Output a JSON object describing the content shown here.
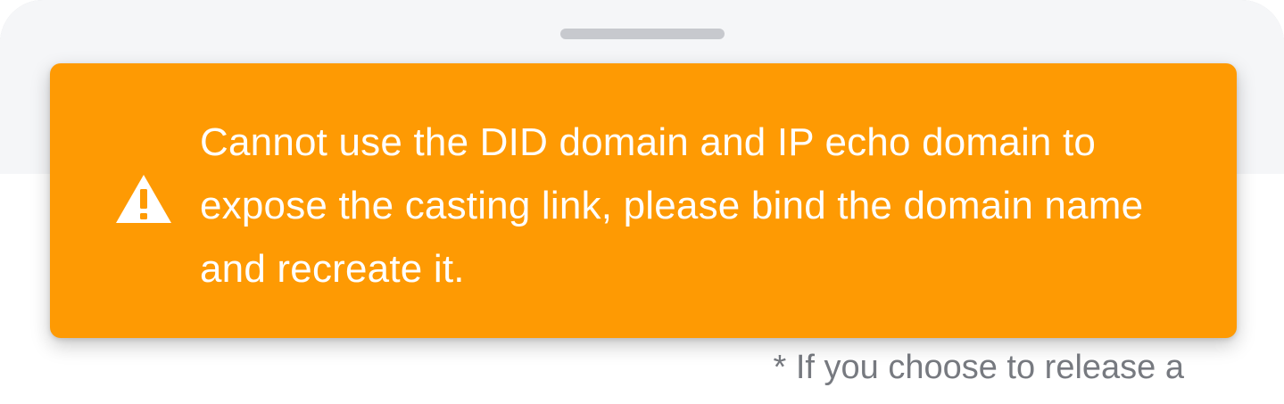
{
  "sheet": {
    "handle": "drag-handle"
  },
  "alert": {
    "type": "warning",
    "icon": "warning-triangle-icon",
    "message": "Cannot use the DID domain and IP echo domain to expose the casting link, please bind the domain name and recreate it.",
    "background_color": "#FE9A03",
    "text_color": "#FFFFFF"
  },
  "footnote": {
    "text": "* If you choose to release a"
  }
}
